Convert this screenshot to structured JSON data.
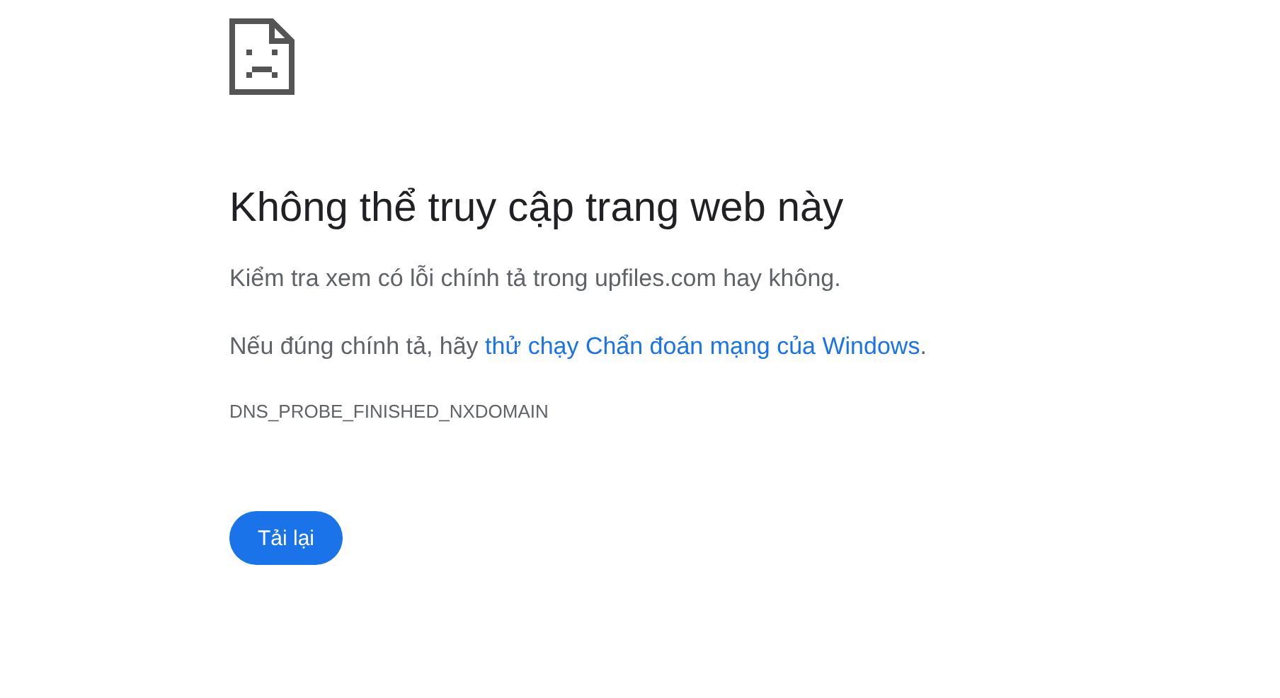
{
  "heading": "Không thể truy cập trang web này",
  "suggestions": [
    {
      "text": "Kiểm tra xem có lỗi chính tả trong upfiles.com hay không."
    },
    {
      "text": "Nếu đúng chính tả, hãy ",
      "link": "thử chạy Chẩn đoán mạng của Windows",
      "after": "."
    }
  ],
  "error_code": "DNS_PROBE_FINISHED_NXDOMAIN",
  "reload_button": "Tải lại"
}
